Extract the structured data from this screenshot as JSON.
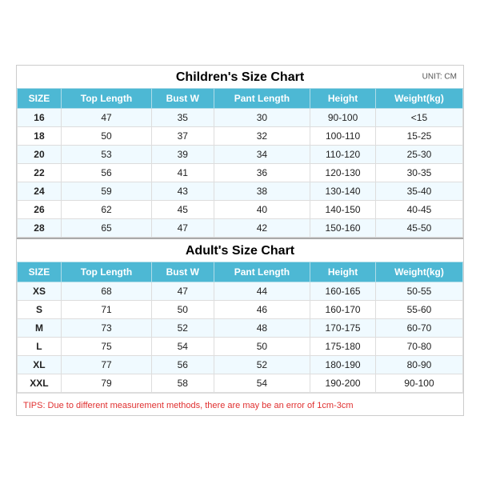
{
  "children_chart": {
    "title": "Children's Size Chart",
    "unit": "UNIT: CM",
    "headers": [
      "SIZE",
      "Top Length",
      "Bust W",
      "Pant Length",
      "Height",
      "Weight(kg)"
    ],
    "rows": [
      [
        "16",
        "47",
        "35",
        "30",
        "90-100",
        "<15"
      ],
      [
        "18",
        "50",
        "37",
        "32",
        "100-110",
        "15-25"
      ],
      [
        "20",
        "53",
        "39",
        "34",
        "110-120",
        "25-30"
      ],
      [
        "22",
        "56",
        "41",
        "36",
        "120-130",
        "30-35"
      ],
      [
        "24",
        "59",
        "43",
        "38",
        "130-140",
        "35-40"
      ],
      [
        "26",
        "62",
        "45",
        "40",
        "140-150",
        "40-45"
      ],
      [
        "28",
        "65",
        "47",
        "42",
        "150-160",
        "45-50"
      ]
    ]
  },
  "adult_chart": {
    "title": "Adult's Size Chart",
    "headers": [
      "SIZE",
      "Top Length",
      "Bust W",
      "Pant Length",
      "Height",
      "Weight(kg)"
    ],
    "rows": [
      [
        "XS",
        "68",
        "47",
        "44",
        "160-165",
        "50-55"
      ],
      [
        "S",
        "71",
        "50",
        "46",
        "160-170",
        "55-60"
      ],
      [
        "M",
        "73",
        "52",
        "48",
        "170-175",
        "60-70"
      ],
      [
        "L",
        "75",
        "54",
        "50",
        "175-180",
        "70-80"
      ],
      [
        "XL",
        "77",
        "56",
        "52",
        "180-190",
        "80-90"
      ],
      [
        "XXL",
        "79",
        "58",
        "54",
        "190-200",
        "90-100"
      ]
    ]
  },
  "tips": "TIPS: Due to different measurement methods, there are may be an error of 1cm-3cm"
}
